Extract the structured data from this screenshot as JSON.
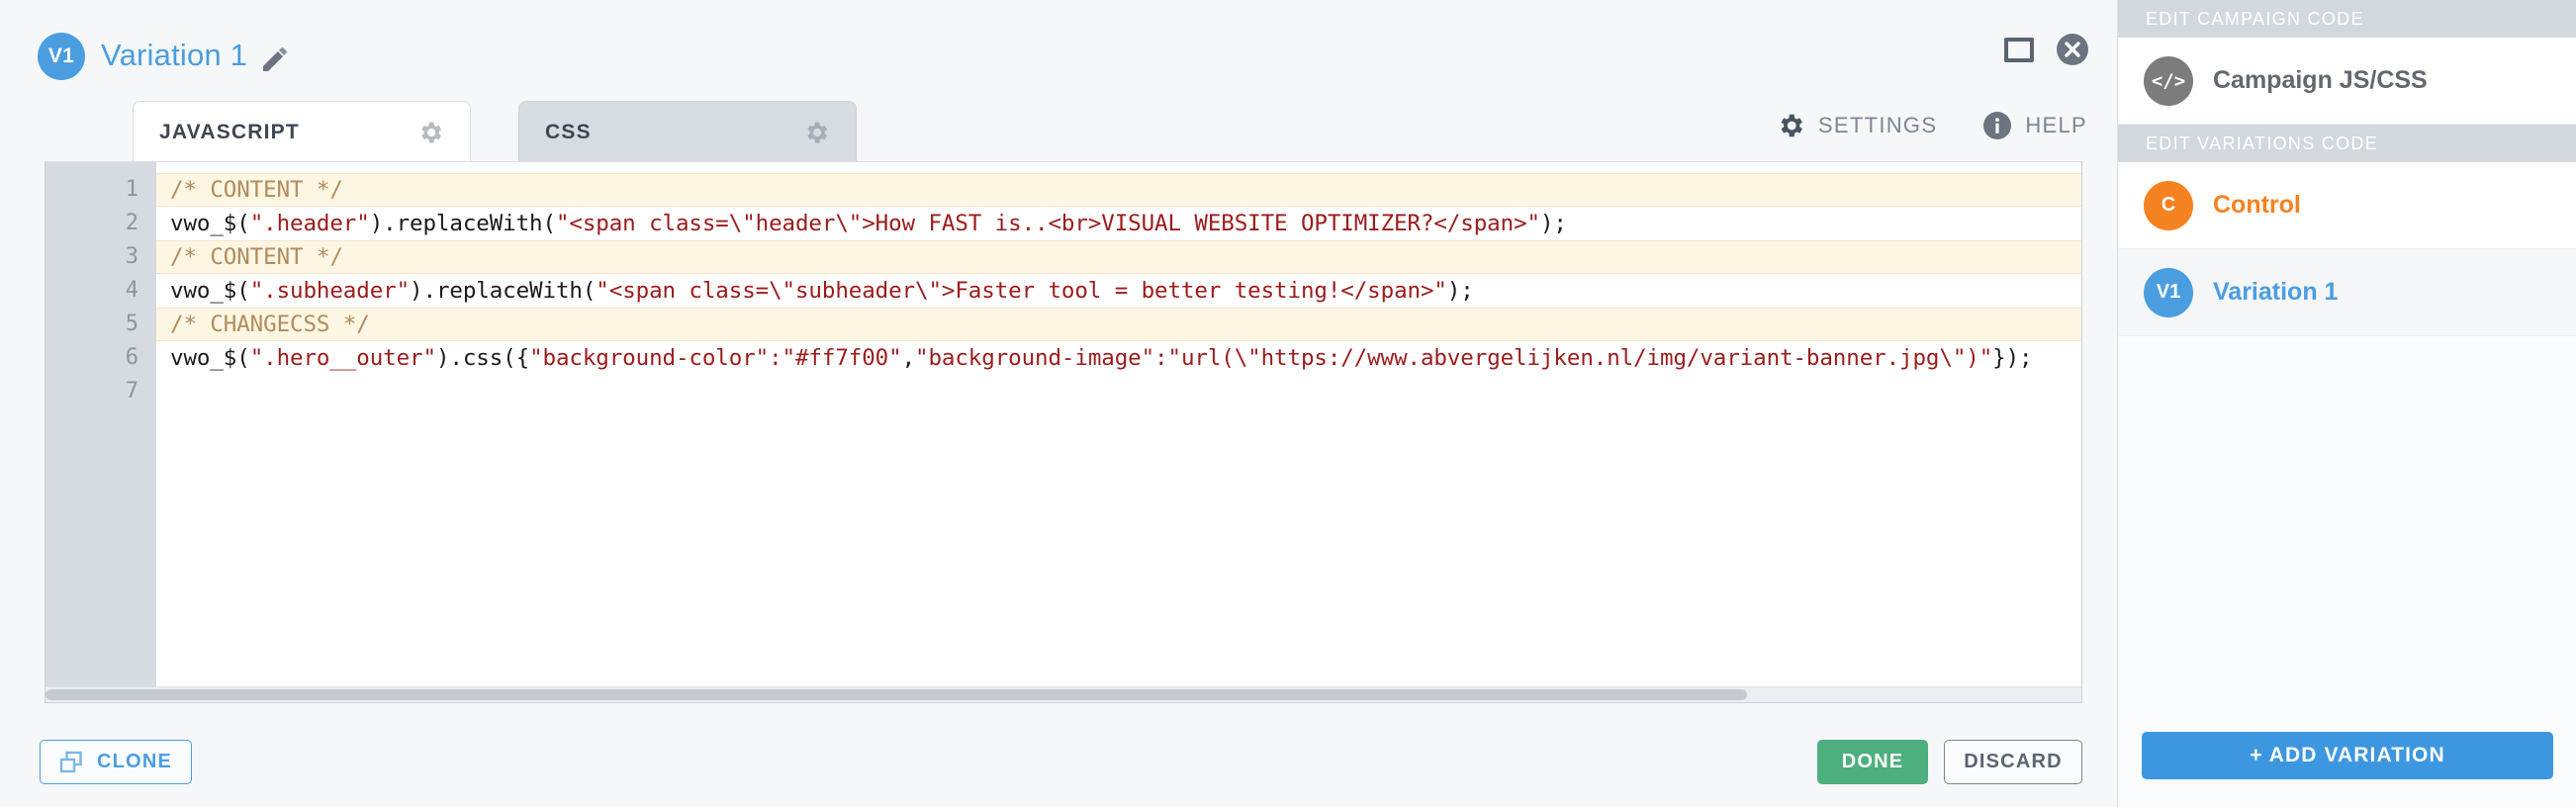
{
  "header": {
    "variation_badge": "V1",
    "variation_title": "Variation 1",
    "edit_icon": "pencil-icon",
    "maximize_icon": "maximize-icon",
    "close_icon": "close-icon"
  },
  "tabs": [
    {
      "label": "JAVASCRIPT",
      "gear_icon": "gear-icon",
      "active": true
    },
    {
      "label": "CSS",
      "gear_icon": "gear-icon",
      "active": false
    }
  ],
  "tools": {
    "settings_label": "SETTINGS",
    "settings_icon": "gear-icon",
    "help_label": "HELP",
    "help_icon": "info-icon"
  },
  "editor": {
    "line_numbers": [
      "1",
      "2",
      "3",
      "4",
      "5",
      "6",
      "7"
    ],
    "lines": [
      {
        "n": "1",
        "type": "comment",
        "text": "/* CONTENT */"
      },
      {
        "n": "2",
        "type": "code",
        "segments": [
          {
            "t": "plain",
            "v": "vwo_$("
          },
          {
            "t": "str",
            "v": "\".header\""
          },
          {
            "t": "plain",
            "v": ").replaceWith("
          },
          {
            "t": "str",
            "v": "\"<span class=\\\"header\\\">How FAST is..<br>VISUAL WEBSITE OPTIMIZER?</span>\""
          },
          {
            "t": "plain",
            "v": ");"
          }
        ]
      },
      {
        "n": "3",
        "type": "comment",
        "text": "/* CONTENT */"
      },
      {
        "n": "4",
        "type": "code",
        "segments": [
          {
            "t": "plain",
            "v": "vwo_$("
          },
          {
            "t": "str",
            "v": "\".subheader\""
          },
          {
            "t": "plain",
            "v": ").replaceWith("
          },
          {
            "t": "str",
            "v": "\"<span class=\\\"subheader\\\">Faster tool = better testing!</span>\""
          },
          {
            "t": "plain",
            "v": ");"
          }
        ]
      },
      {
        "n": "5",
        "type": "comment",
        "text": "/* CHANGECSS */"
      },
      {
        "n": "6",
        "type": "code",
        "segments": [
          {
            "t": "plain",
            "v": "vwo_$("
          },
          {
            "t": "str",
            "v": "\".hero__outer\""
          },
          {
            "t": "plain",
            "v": ").css({"
          },
          {
            "t": "str",
            "v": "\"background-color\":\"#ff7f00\""
          },
          {
            "t": "plain",
            "v": ","
          },
          {
            "t": "str",
            "v": "\"background-image\":\"url(\\\"https://www.abvergelijken.nl/img/variant-banner.jpg\\\")\""
          },
          {
            "t": "plain",
            "v": "});"
          }
        ]
      },
      {
        "n": "7",
        "type": "blank",
        "text": ""
      }
    ]
  },
  "footer": {
    "clone_label": "CLONE",
    "clone_icon": "copy-icon",
    "done_label": "DONE",
    "discard_label": "DISCARD"
  },
  "sidebar": {
    "section_campaign": "EDIT CAMPAIGN CODE",
    "campaign_item": {
      "badge": "</>",
      "label": "Campaign JS/CSS"
    },
    "section_variations": "EDIT VARIATIONS CODE",
    "variations": [
      {
        "badge": "C",
        "label": "Control",
        "selected": false
      },
      {
        "badge": "V1",
        "label": "Variation 1",
        "selected": true
      }
    ],
    "add_variation_label": "+ ADD VARIATION"
  },
  "colors": {
    "accent_blue": "#4a9ee0",
    "orange": "#f58220",
    "green": "#4caf7d",
    "code_string": "#9c1b1b",
    "comment": "#b28b5a"
  }
}
